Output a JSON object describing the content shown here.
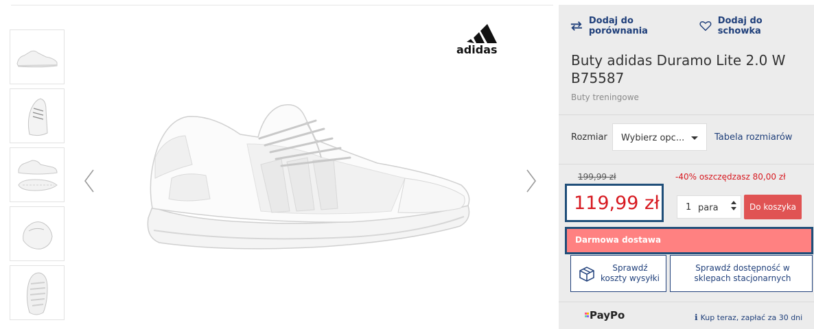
{
  "product": {
    "title": "Buty adidas Duramo Lite 2.0 W B75587",
    "category": "Buty treningowe",
    "brand_logo_text": "adidas"
  },
  "actions": {
    "compare_label": "Dodaj do porównania",
    "wishlist_label": "Dodaj do schowka"
  },
  "size": {
    "label": "Rozmiar",
    "selected": "Wybierz opc...",
    "table_link": "Tabela rozmiarów"
  },
  "pricing": {
    "old_price": "199,99 zł",
    "discount": "-40% oszczędzasz 80,00 zł",
    "price": "119,99 zł"
  },
  "cart": {
    "quantity": "1",
    "unit": "para",
    "add_label": "Do koszyka"
  },
  "delivery": {
    "label": "Darmowa dostawa"
  },
  "buttons": {
    "shipping_label": "Sprawdź koszty wysyłki",
    "stores_label": "Sprawdź dostępność w sklepach stacjonarnych"
  },
  "payment": {
    "provider": "PayPo",
    "note": "Kup teraz, zapłać za 30 dni"
  },
  "gallery": {
    "thumbnail_count": 5
  },
  "colors": {
    "accent_blue": "#1f3f7a",
    "price_red": "#d71920",
    "cart_button": "#e05353",
    "delivery_bg": "#ff8181",
    "highlight_border": "#1f4e79",
    "panel_bg": "#ececec"
  }
}
